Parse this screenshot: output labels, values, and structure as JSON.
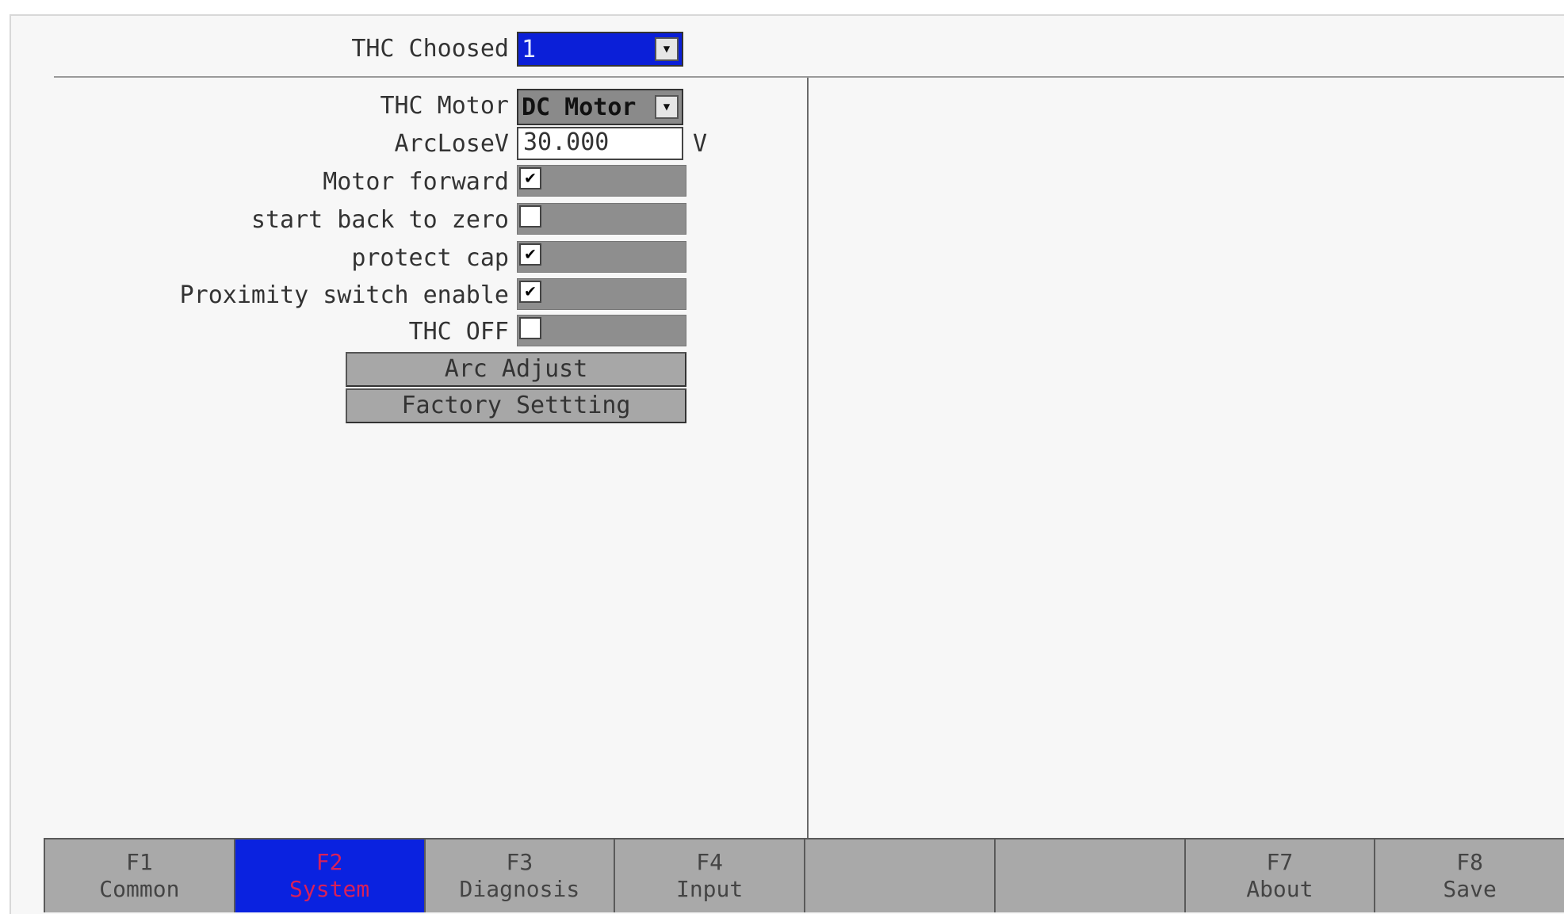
{
  "thc_choosed": {
    "label": "THC Choosed",
    "value": "1"
  },
  "thc_motor": {
    "label": "THC Motor",
    "value": "DC Motor"
  },
  "arc_lose_v": {
    "label": "ArcLoseV",
    "value": "30.000",
    "unit": "V"
  },
  "checkboxes": [
    {
      "label": "Motor forward",
      "checked": true,
      "mark": "✔"
    },
    {
      "label": "start back to zero",
      "checked": false,
      "mark": ""
    },
    {
      "label": "protect cap",
      "checked": true,
      "mark": "✔"
    },
    {
      "label": "Proximity switch enable",
      "checked": true,
      "mark": "✔"
    },
    {
      "label": "THC OFF",
      "checked": false,
      "mark": ""
    }
  ],
  "buttons": {
    "arc_adjust": "Arc Adjust",
    "factory_setting": "Factory Settting"
  },
  "function_keys": [
    {
      "key": "F1",
      "label": "Common",
      "active": false
    },
    {
      "key": "F2",
      "label": "System",
      "active": true
    },
    {
      "key": "F3",
      "label": "Diagnosis",
      "active": false
    },
    {
      "key": "F4",
      "label": "Input",
      "active": false
    },
    {
      "key": "",
      "label": "",
      "active": false
    },
    {
      "key": "",
      "label": "",
      "active": false
    },
    {
      "key": "F7",
      "label": "About",
      "active": false
    },
    {
      "key": "F8",
      "label": "Save",
      "active": false
    }
  ],
  "colors": {
    "active_blue": "#0a22e0",
    "panel_gray": "#8e8e8e"
  }
}
